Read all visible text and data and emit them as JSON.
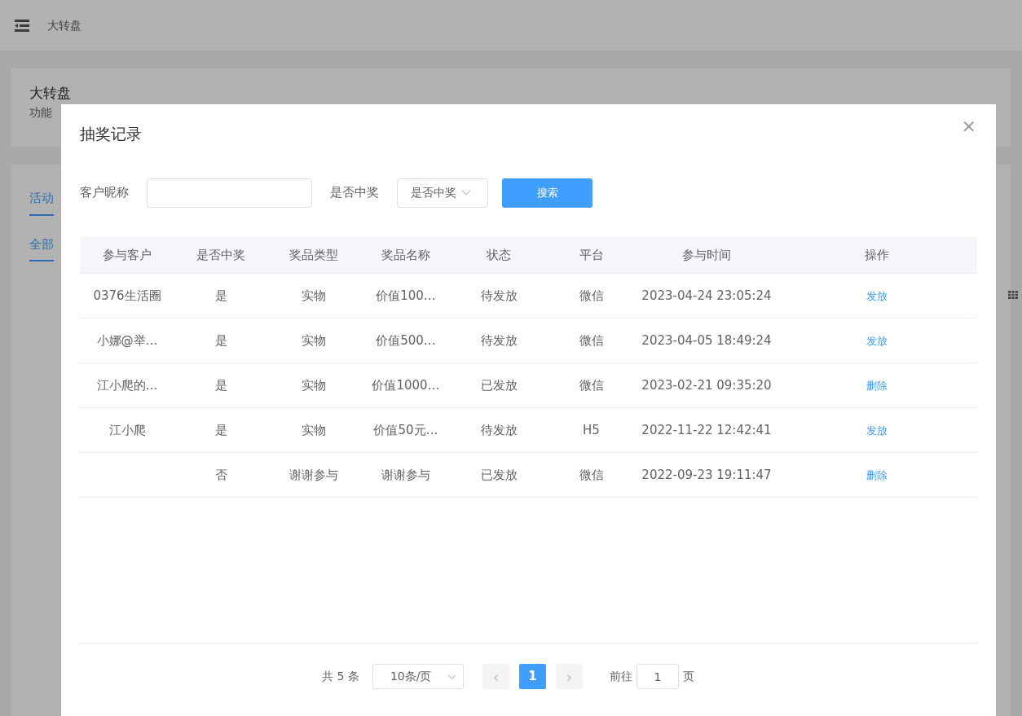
{
  "background": {
    "header_title": "大转盘",
    "card_title": "大转盘",
    "card_subtitle": "功能",
    "tabs": [
      {
        "label": "活动",
        "selected": true
      }
    ],
    "subtabs": [
      {
        "label": "全部",
        "selected": true
      }
    ]
  },
  "dialog": {
    "title": "抽奖记录",
    "close": "×",
    "filters": [
      {
        "kind": "input",
        "label": "客户昵称"
      },
      {
        "kind": "select",
        "label": "是否中奖",
        "placeholder": "是否中奖"
      }
    ],
    "search_button": "搜索",
    "table": {
      "columns": [
        "参与客户",
        "是否中奖",
        "奖品类型",
        "奖品名称",
        "状态",
        "平台",
        "参与时间",
        "操作"
      ],
      "rows": [
        {
          "cells": [
            "0376生活圈",
            "是",
            "实物",
            "价值100…",
            "待发放",
            "微信",
            "2023-04-24 23:05:24"
          ],
          "action": "发放"
        },
        {
          "cells": [
            "小娜@举…",
            "是",
            "实物",
            "价值500…",
            "待发放",
            "微信",
            "2023-04-05 18:49:24"
          ],
          "action": "发放"
        },
        {
          "cells": [
            "江小爬的…",
            "是",
            "实物",
            "价值1000…",
            "已发放",
            "微信",
            "2023-02-21 09:35:20"
          ],
          "action": "删除"
        },
        {
          "cells": [
            "江小爬",
            "是",
            "实物",
            "价值50元…",
            "待发放",
            "H5",
            "2022-11-22 12:42:41"
          ],
          "action": "发放"
        },
        {
          "cells": [
            "",
            "否",
            "谢谢参与",
            "谢谢参与",
            "已发放",
            "微信",
            "2022-09-23 19:11:47"
          ],
          "action": "删除"
        }
      ]
    },
    "pagination": {
      "total": "共 5 条",
      "page_size": "10条/页",
      "prev": "‹",
      "pages": [
        {
          "label": "1",
          "selected": true
        }
      ],
      "next": "›",
      "goto_label": "前往",
      "goto_value": "1",
      "goto_suffix": "页"
    }
  }
}
